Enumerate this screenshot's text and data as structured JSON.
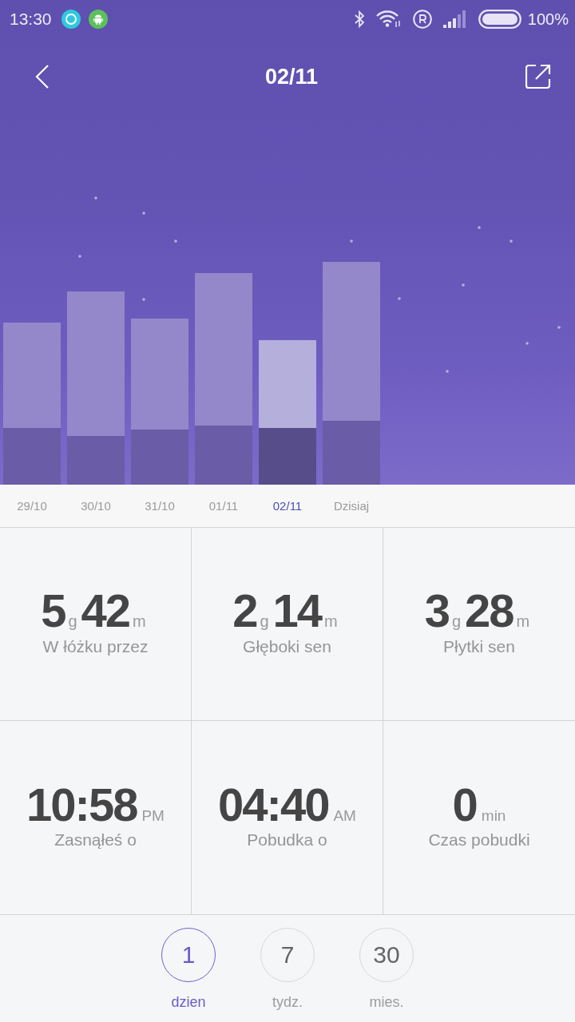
{
  "status_bar": {
    "time": "13:30",
    "battery": "100%"
  },
  "header": {
    "title": "02/11"
  },
  "sleep_chart": {
    "days": [
      {
        "label": "29/10",
        "selected": false
      },
      {
        "label": "30/10",
        "selected": false
      },
      {
        "label": "31/10",
        "selected": false
      },
      {
        "label": "01/11",
        "selected": false
      },
      {
        "label": "02/11",
        "selected": true
      },
      {
        "label": "Dzisiaj",
        "selected": false
      }
    ]
  },
  "stats": [
    {
      "kind": "duration",
      "hours": "5",
      "hours_unit": "g",
      "minutes": "42",
      "minutes_unit": "m",
      "label": "W łóżku przez"
    },
    {
      "kind": "duration",
      "hours": "2",
      "hours_unit": "g",
      "minutes": "14",
      "minutes_unit": "m",
      "label": "Głęboki sen"
    },
    {
      "kind": "duration",
      "hours": "3",
      "hours_unit": "g",
      "minutes": "28",
      "minutes_unit": "m",
      "label": "Płytki sen"
    },
    {
      "kind": "value",
      "value": "10:58",
      "unit": "PM",
      "label": "Zasnąłeś o"
    },
    {
      "kind": "value",
      "value": "04:40",
      "unit": "AM",
      "label": "Pobudka o"
    },
    {
      "kind": "value",
      "value": "0",
      "unit": "min",
      "label": "Czas pobudki"
    }
  ],
  "period_tabs": [
    {
      "number": "1",
      "label": "dzien",
      "selected": true
    },
    {
      "number": "7",
      "label": "tydz.",
      "selected": false
    },
    {
      "number": "30",
      "label": "mies.",
      "selected": false
    }
  ]
}
